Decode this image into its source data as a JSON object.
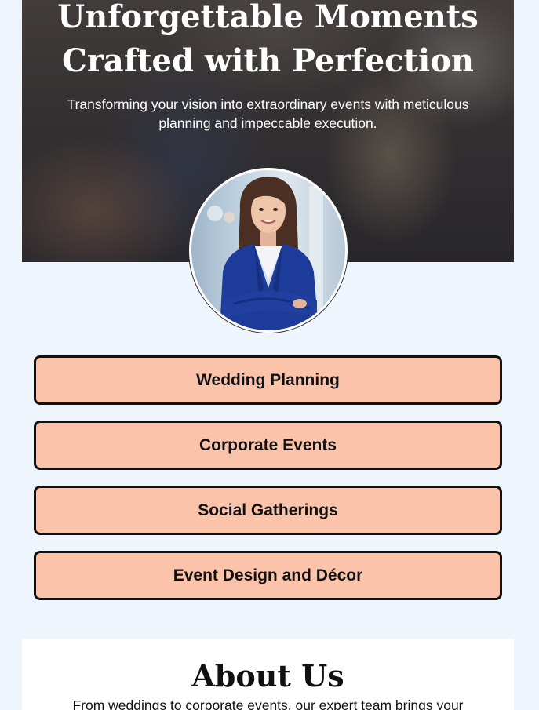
{
  "hero": {
    "title_line1": "Unforgettable Moments",
    "title_line2": "Crafted with Perfection",
    "subtitle_line1": "Transforming your vision into extraordinary events with meticulous",
    "subtitle_line2": "planning and impeccable execution."
  },
  "avatar": {
    "icon": "portrait-photo"
  },
  "services": [
    {
      "label": "Wedding Planning"
    },
    {
      "label": "Corporate Events"
    },
    {
      "label": "Social Gatherings"
    },
    {
      "label": "Event Design and Décor"
    }
  ],
  "about": {
    "title": "About Us",
    "text": "From weddings to corporate events, our expert team brings your"
  },
  "colors": {
    "page_background": "#eef5fd",
    "button_fill": "#fcc3ab",
    "button_border": "#111111",
    "blazer": "#1d3c9a"
  }
}
